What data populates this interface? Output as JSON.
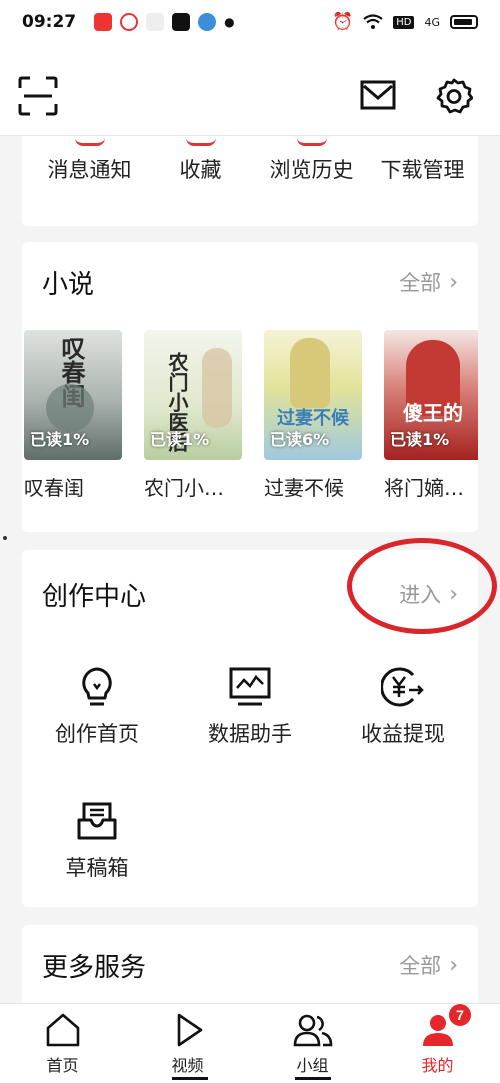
{
  "status_bar": {
    "time": "09:27",
    "network": "4G"
  },
  "top_bar": {
    "scan_icon": "scan-icon",
    "mail_icon": "mail-icon",
    "settings_icon": "gear-icon"
  },
  "quick_actions": [
    "消息通知",
    "收藏",
    "浏览历史",
    "下载管理"
  ],
  "novel": {
    "title": "小说",
    "more": "全部",
    "books": [
      {
        "name": "叹春闺",
        "progress": "已读1%",
        "cover_text": "叹春闺",
        "colors": [
          "#d8dcd9",
          "#5d6b68"
        ]
      },
      {
        "name": "农门小…",
        "progress": "已读1%",
        "cover_text": "农门小医后",
        "colors": [
          "#eef0e6",
          "#c9d6b0"
        ]
      },
      {
        "name": "过妻不候",
        "progress": "已读6%",
        "cover_text": "过妻不候",
        "colors": [
          "#e8eaba",
          "#9dc5d8"
        ]
      },
      {
        "name": "将门嫡…",
        "progress": "已读1%",
        "cover_text": "傻王的",
        "colors": [
          "#f1dcd8",
          "#b2302c"
        ]
      }
    ]
  },
  "creation": {
    "title": "创作中心",
    "enter": "进入",
    "tools": [
      {
        "label": "创作首页",
        "icon": "lightbulb-icon"
      },
      {
        "label": "数据助手",
        "icon": "chart-monitor-icon"
      },
      {
        "label": "收益提现",
        "icon": "yuan-withdraw-icon"
      },
      {
        "label": "草稿箱",
        "icon": "draft-box-icon"
      }
    ]
  },
  "more_services": {
    "title": "更多服务",
    "more": "全部"
  },
  "tab_bar": {
    "tabs": [
      "首页",
      "视频",
      "小组",
      "我的"
    ],
    "badge": "7",
    "active_color": "#e5262b"
  }
}
